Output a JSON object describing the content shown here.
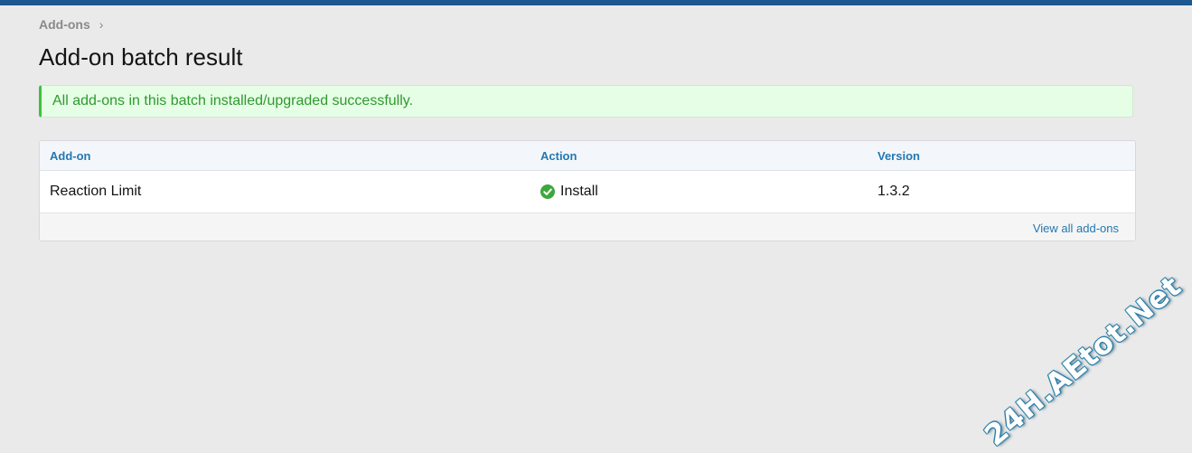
{
  "breadcrumb": {
    "item": "Add-ons",
    "separator": "›"
  },
  "page": {
    "title": "Add-on batch result"
  },
  "alert": {
    "message": "All add-ons in this batch installed/upgraded successfully.",
    "color": "#2e9a2e"
  },
  "table": {
    "headers": {
      "addon": "Add-on",
      "action": "Action",
      "version": "Version"
    },
    "rows": [
      {
        "addon": "Reaction Limit",
        "action": "Install",
        "action_icon": "check-circle-icon",
        "version": "1.3.2"
      }
    ],
    "footer_link": "View all add-ons"
  },
  "watermark": "24H.AEtot.Net",
  "colors": {
    "topbar": "#1d5890",
    "link": "#2577b1",
    "success": "#3ca83c"
  }
}
